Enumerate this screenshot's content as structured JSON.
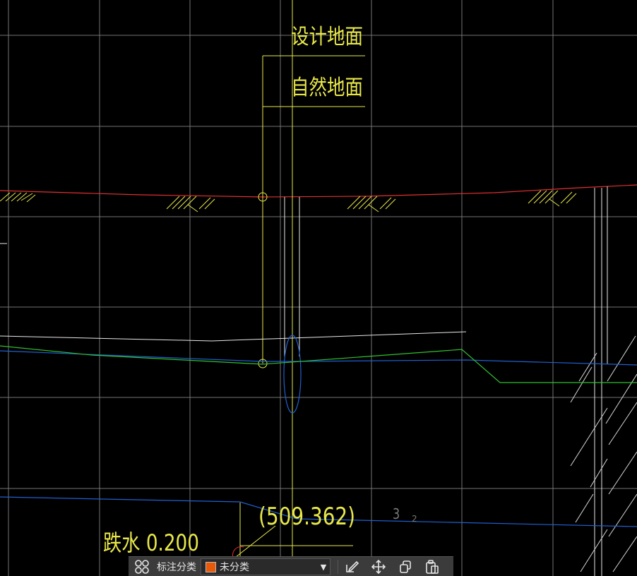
{
  "drawing": {
    "label_design_ground": "设计地面",
    "label_natural_ground": "自然地面",
    "label_drop": "跌水 0.200",
    "label_elevation": "(509.362)",
    "label_small_3": "3",
    "label_small_2": "2",
    "colors": {
      "background": "#000000",
      "grid": "#8a8a8a",
      "design_line": "#e03030",
      "profile_green": "#30c030",
      "pipe_blue": "#2060d0",
      "annotation_yellow": "#e8e84a",
      "white": "#e8e8e8"
    }
  },
  "toolbar": {
    "category_label": "标注分类",
    "category_value": "未分类",
    "category_swatch": "#e85a0a",
    "grid_icon": "grid-four-circles-icon",
    "buttons": [
      {
        "icon": "edit-icon"
      },
      {
        "icon": "move-icon"
      },
      {
        "icon": "copy-icon"
      },
      {
        "icon": "paste-icon"
      }
    ]
  }
}
